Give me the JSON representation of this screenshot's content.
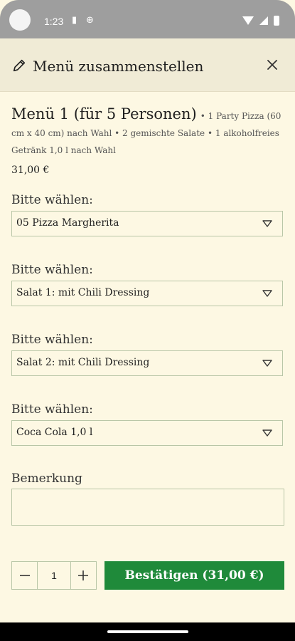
{
  "status_bar": {
    "time": "1:23"
  },
  "header": {
    "title": "Menü zusammenstellen"
  },
  "menu": {
    "title": "Menü 1 (für 5 Personen)",
    "description": "• 1 Party Pizza (60 cm x 40 cm) nach Wahl • 2 gemischte Salate • 1 alkoholfreies Getränk 1,0 l nach Wahl",
    "price": "31,00 €"
  },
  "choices": [
    {
      "label": "Bitte wählen:",
      "value": "05 Pizza Margherita"
    },
    {
      "label": "Bitte wählen:",
      "value": "Salat 1: mit Chili Dressing"
    },
    {
      "label": "Bitte wählen:",
      "value": "Salat 2: mit Chili Dressing"
    },
    {
      "label": "Bitte wählen:",
      "value": "Coca Cola 1,0 l"
    }
  ],
  "remark": {
    "label": "Bemerkung",
    "value": ""
  },
  "quantity": {
    "value": "1"
  },
  "confirm": {
    "label": "Bestätigen (31,00 €)"
  },
  "colors": {
    "accent": "#1f8a3a",
    "background": "#fdf8e3",
    "header_background": "#f0ebd6",
    "border": "#b9c6a7"
  },
  "icons": {
    "edit": "pencil-icon",
    "close": "close-icon",
    "dropdown": "chevron-down-icon",
    "minus": "minus-icon",
    "plus": "plus-icon"
  }
}
